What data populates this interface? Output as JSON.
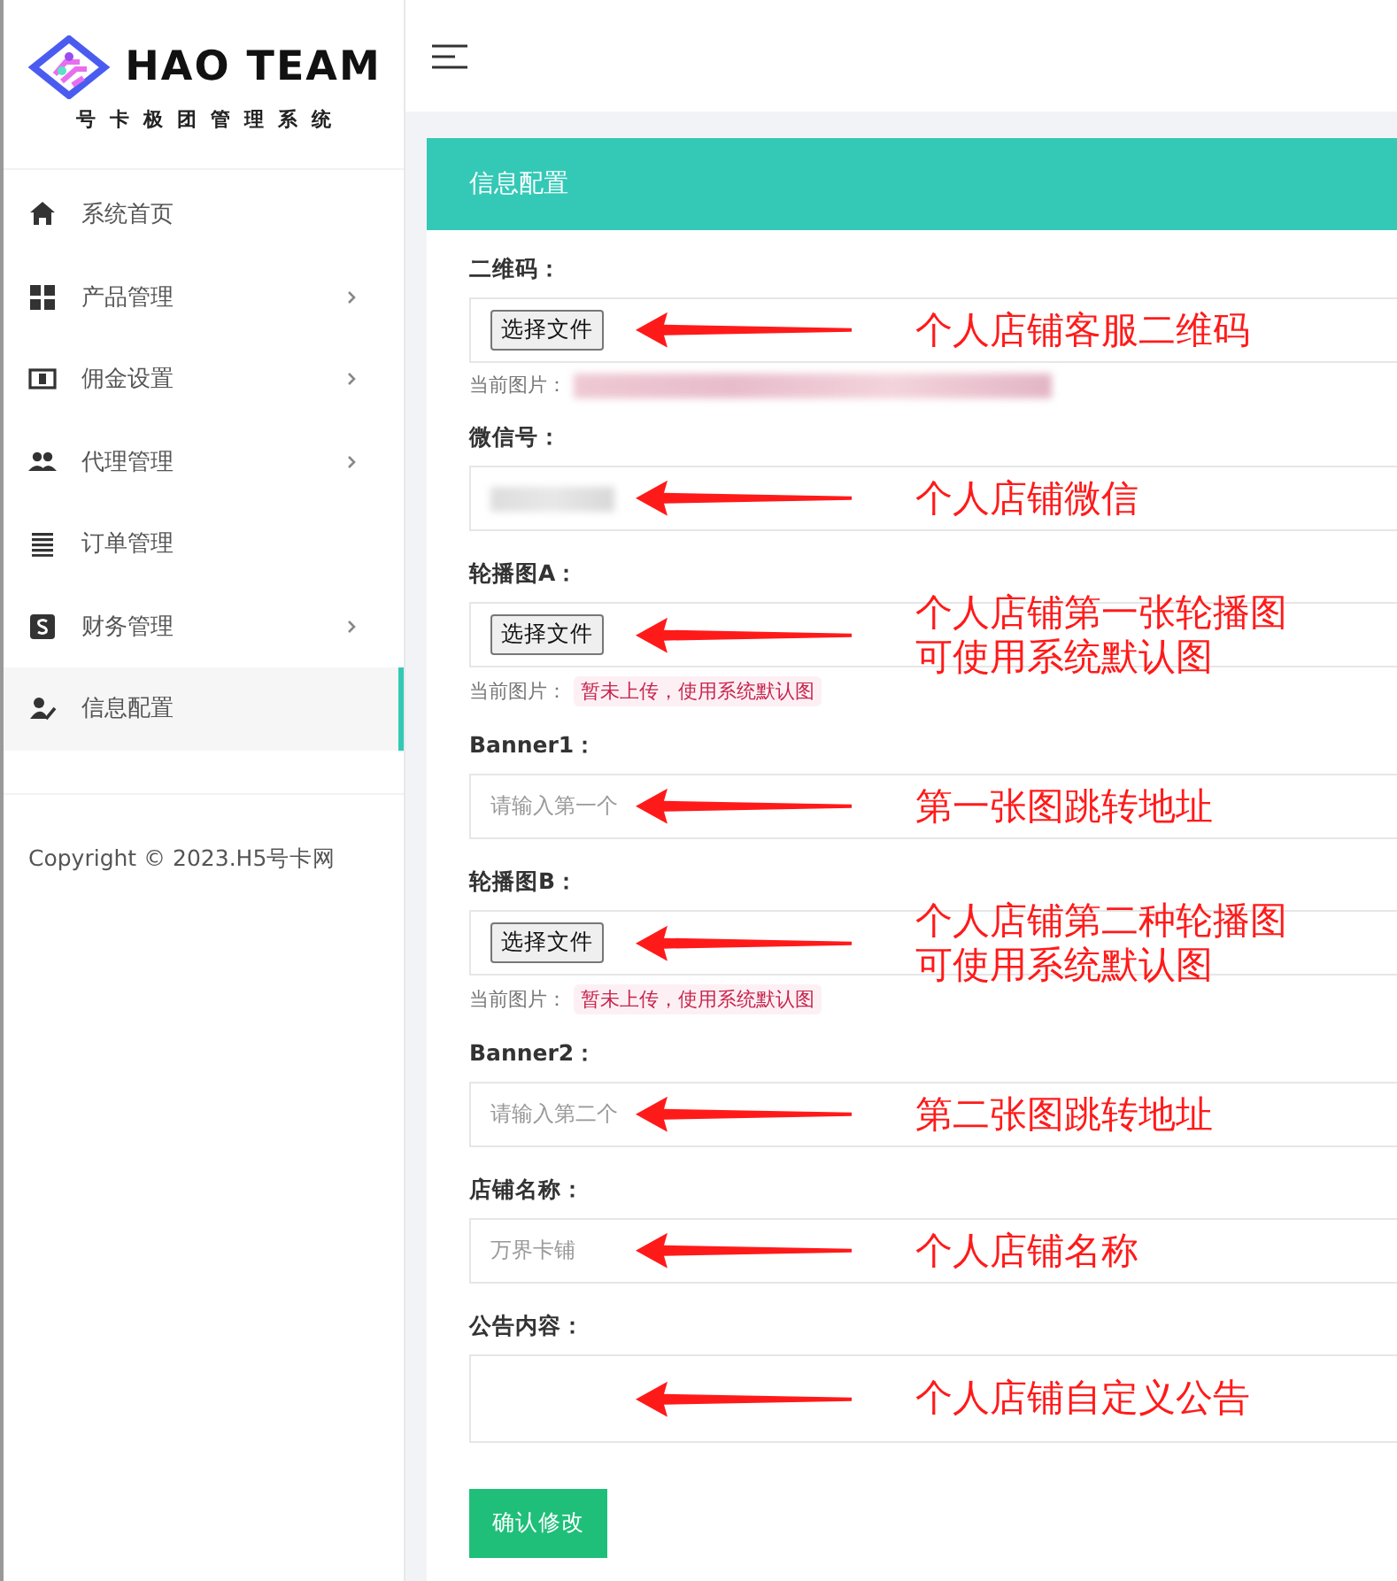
{
  "sidebar": {
    "logo": {
      "title": "HAO TEAM",
      "subtitle": "号卡极团管理系统"
    },
    "items": [
      {
        "label": "系统首页",
        "has_submenu": false,
        "selected": false
      },
      {
        "label": "产品管理",
        "has_submenu": true,
        "selected": false
      },
      {
        "label": "佣金设置",
        "has_submenu": true,
        "selected": false
      },
      {
        "label": "代理管理",
        "has_submenu": true,
        "selected": false
      },
      {
        "label": "订单管理",
        "has_submenu": false,
        "selected": false
      },
      {
        "label": "财务管理",
        "has_submenu": true,
        "selected": false
      },
      {
        "label": "信息配置",
        "has_submenu": false,
        "selected": true
      }
    ],
    "copyright": "Copyright © 2023.H5号卡网"
  },
  "card": {
    "title": "信息配置",
    "fields": [
      {
        "kind": "file",
        "label": "二维码：",
        "button": "选择文件",
        "current": {
          "label": "当前图片：",
          "redacted": true
        },
        "annotation": [
          "个人店铺客服二维码"
        ]
      },
      {
        "kind": "text",
        "label": "微信号：",
        "redacted": true,
        "annotation": [
          "个人店铺微信"
        ]
      },
      {
        "kind": "file",
        "label": "轮播图A：",
        "button": "选择文件",
        "current": {
          "label": "当前图片：",
          "value": "暂未上传，使用系统默认图"
        },
        "annotation": [
          "个人店铺第一张轮播图",
          "可使用系统默认图"
        ]
      },
      {
        "kind": "text",
        "label": "Banner1：",
        "placeholder": "请输入第一个",
        "annotation": [
          "第一张图跳转地址"
        ]
      },
      {
        "kind": "file",
        "label": "轮播图B：",
        "button": "选择文件",
        "current": {
          "label": "当前图片：",
          "value": "暂未上传，使用系统默认图"
        },
        "annotation": [
          "个人店铺第二种轮播图",
          "可使用系统默认图"
        ]
      },
      {
        "kind": "text",
        "label": "Banner2：",
        "placeholder": "请输入第二个",
        "annotation": [
          "第二张图跳转地址"
        ]
      },
      {
        "kind": "text",
        "label": "店铺名称：",
        "placeholder": "万界卡铺",
        "annotation": [
          "个人店铺名称"
        ]
      },
      {
        "kind": "textarea",
        "label": "公告内容：",
        "annotation": [
          "个人店铺自定义公告"
        ]
      }
    ],
    "submit": "确认修改"
  }
}
